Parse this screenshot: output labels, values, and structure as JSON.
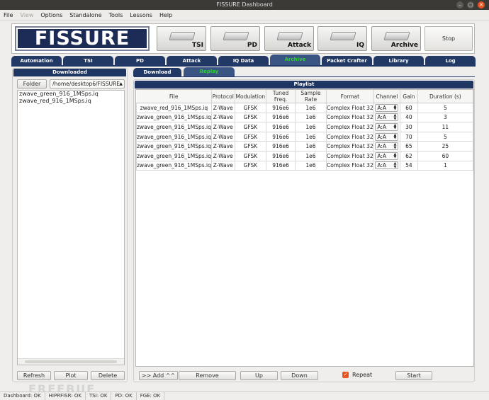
{
  "window": {
    "title": "FISSURE Dashboard"
  },
  "menu": [
    "File",
    "View",
    "Options",
    "Standalone",
    "Tools",
    "Lessons",
    "Help"
  ],
  "banner": {
    "logo": "FISSURE",
    "buttons": [
      "TSI",
      "PD",
      "Attack",
      "IQ",
      "Archive"
    ],
    "stop_label": "Stop"
  },
  "tabs": [
    "Automation",
    "TSI",
    "PD",
    "Attack",
    "IQ Data",
    "Archive",
    "Packet Crafter",
    "Library",
    "Log"
  ],
  "left": {
    "header": "Downloaded",
    "folder_label": "Folder",
    "path": "/home/desktop6/FISSURE",
    "files": [
      "zwave_green_916_1MSps.iq",
      "zwave_red_916_1MSps.iq"
    ],
    "buttons": [
      "Refresh",
      "Plot",
      "Delete"
    ]
  },
  "subtabs": [
    "Download",
    "Replay"
  ],
  "playlist": {
    "header": "Playlist",
    "columns": [
      "File",
      "Protocol",
      "Modulation",
      "Tuned Freq.",
      "Sample Rate",
      "Format",
      "Channel",
      "Gain",
      "Duration (s)"
    ],
    "rows": [
      [
        "zwave_red_916_1MSps.iq",
        "Z-Wave",
        "GFSK",
        "916e6",
        "1e6",
        "Complex Float 32",
        "A:A",
        "60",
        "5"
      ],
      [
        "zwave_green_916_1MSps.iq",
        "Z-Wave",
        "GFSK",
        "916e6",
        "1e6",
        "Complex Float 32",
        "A:A",
        "40",
        "3"
      ],
      [
        "zwave_green_916_1MSps.iq",
        "Z-Wave",
        "GFSK",
        "916e6",
        "1e6",
        "Complex Float 32",
        "A:A",
        "30",
        "11"
      ],
      [
        "zwave_green_916_1MSps.iq",
        "Z-Wave",
        "GFSK",
        "916e6",
        "1e6",
        "Complex Float 32",
        "A:A",
        "70",
        "5"
      ],
      [
        "zwave_green_916_1MSps.iq",
        "Z-Wave",
        "GFSK",
        "916e6",
        "1e6",
        "Complex Float 32",
        "A:A",
        "65",
        "25"
      ],
      [
        "zwave_green_916_1MSps.iq",
        "Z-Wave",
        "GFSK",
        "916e6",
        "1e6",
        "Complex Float 32",
        "A:A",
        "62",
        "60"
      ],
      [
        "zwave_green_916_1MSps.iq",
        "Z-Wave",
        "GFSK",
        "916e6",
        "1e6",
        "Complex Float 32",
        "A:A",
        "54",
        "1"
      ]
    ],
    "add_label": ">> Add ^^",
    "remove_label": "Remove",
    "up_label": "Up",
    "down_label": "Down",
    "repeat_label": "Repeat",
    "start_label": "Start"
  },
  "status": [
    "Dashboard: OK",
    "HIPRFISR: OK",
    "TSI: OK",
    "PD: OK",
    "FGE: OK"
  ],
  "watermark": "FREEBUF"
}
